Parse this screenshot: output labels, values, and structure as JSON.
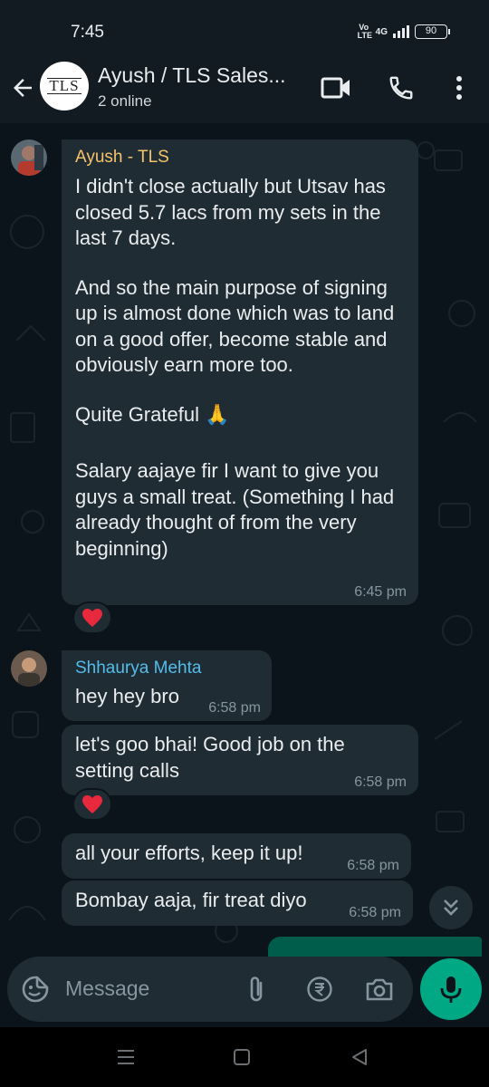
{
  "status_bar": {
    "time": "7:45",
    "volte": "Vo LTE",
    "network": "4G",
    "battery": "90"
  },
  "header": {
    "avatar_logo": "TLS",
    "title": "Ayush / TLS Sales...",
    "subtitle": "2 online",
    "icons": [
      "back-arrow-icon",
      "video-call-icon",
      "phone-icon",
      "more-vert-icon"
    ]
  },
  "messages": [
    {
      "sender": "Ayush - TLS",
      "sender_color": "#f5c36b",
      "paragraphs": [
        "I didn't close actually but Utsav has closed 5.7 lacs from my sets in the last 7 days.",
        "And so the main purpose of signing up is almost done which was to land on a good offer, become stable and obviously earn more too.",
        "Quite Grateful 🙏",
        "Salary aajaye fir I want to give you guys a small treat. (Something I had already thought of from the very beginning)"
      ],
      "time": "6:45 pm",
      "reaction": "❤️"
    },
    {
      "sender": "Shhaurya Mehta",
      "sender_color": "#53bdeb",
      "text": "hey hey bro",
      "time": "6:58 pm"
    },
    {
      "text": "let's goo bhai! Good job on the setting calls",
      "time": "6:58 pm",
      "reaction": "❤️"
    },
    {
      "text": "all your efforts, keep it up!",
      "time": "6:58 pm"
    },
    {
      "text": "Bombay aaja, fir treat diyo",
      "time": "6:58 pm"
    }
  ],
  "input": {
    "placeholder": "Message",
    "icons": [
      "emoji-icon",
      "attach-icon",
      "rupee-payment-icon",
      "camera-icon",
      "mic-icon"
    ]
  },
  "colors": {
    "background": "#0b141a",
    "bubble_incoming": "#202c33",
    "bubble_outgoing": "#005c4b",
    "accent": "#00a884"
  }
}
